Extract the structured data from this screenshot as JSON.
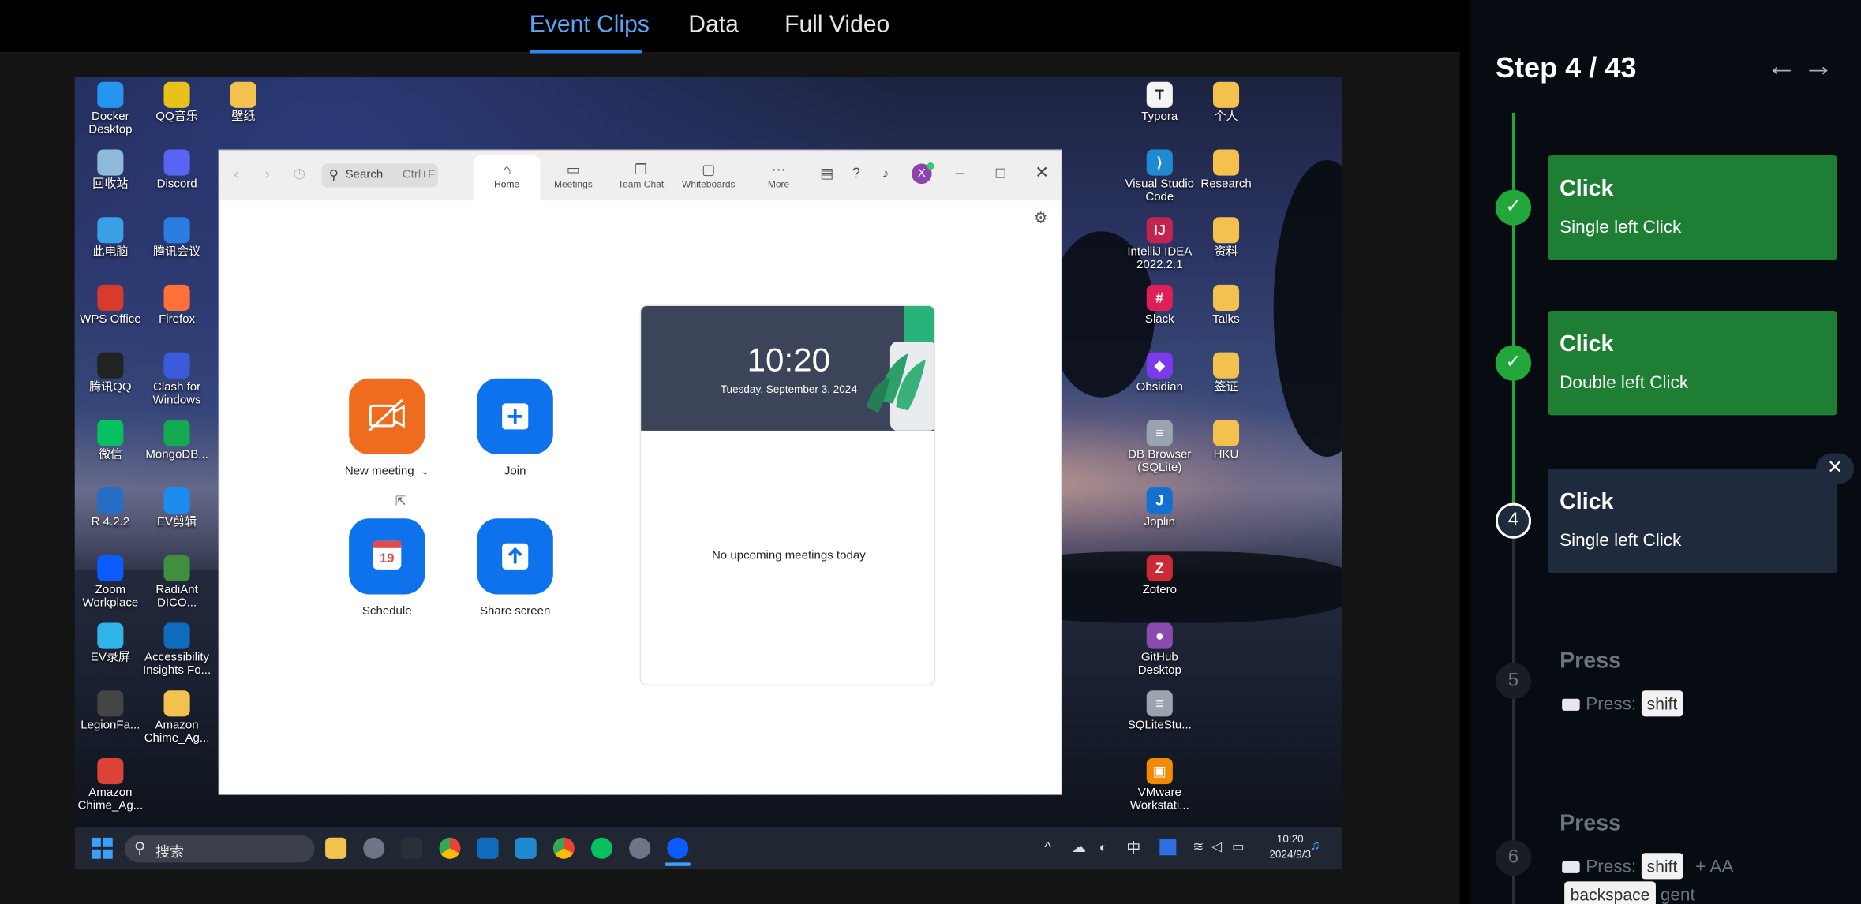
{
  "tabs": [
    "Event Clips",
    "Data",
    "Full Video"
  ],
  "desktop": {
    "left_icons": [
      {
        "label": "Docker Desktop",
        "icon": "docker-icon",
        "color": "#2496ed"
      },
      {
        "label": "QQ音乐",
        "icon": "qqmusic-icon",
        "color": "#e8c21b"
      },
      {
        "label": "壁纸",
        "icon": "folder-icon",
        "color": "#f2c14e"
      },
      {
        "label": "回收站",
        "icon": "recycle-bin-icon",
        "color": "#8fb9d9"
      },
      {
        "label": "Discord",
        "icon": "discord-icon",
        "color": "#5865f2"
      },
      {
        "label": "此电脑",
        "icon": "computer-icon",
        "color": "#3aa0e6"
      },
      {
        "label": "腾讯会议",
        "icon": "tencent-meeting-icon",
        "color": "#2a7de1"
      },
      {
        "label": "WPS Office",
        "icon": "wps-icon",
        "color": "#d73b2c"
      },
      {
        "label": "Firefox",
        "icon": "firefox-icon",
        "color": "#ff7139"
      },
      {
        "label": "腾讯QQ",
        "icon": "qq-icon",
        "color": "#222222"
      },
      {
        "label": "Clash for Windows",
        "icon": "clash-icon",
        "color": "#3b5bdb"
      },
      {
        "label": "微信",
        "icon": "wechat-icon",
        "color": "#07c160"
      },
      {
        "label": "MongoDB...",
        "icon": "mongodb-icon",
        "color": "#13aa52"
      },
      {
        "label": "R 4.2.2",
        "icon": "r-icon",
        "color": "#276dc3"
      },
      {
        "label": "EV剪辑",
        "icon": "ev-edit-icon",
        "color": "#1c8cf0"
      },
      {
        "label": "Zoom Workplace",
        "icon": "zoom-icon",
        "color": "#0b5cff"
      },
      {
        "label": "RadiAnt DICO...",
        "icon": "radiant-icon",
        "color": "#3f8f3f"
      },
      {
        "label": "EV录屏",
        "icon": "ev-record-icon",
        "color": "#2fb5e8"
      },
      {
        "label": "Accessibility Insights Fo...",
        "icon": "accessibility-icon",
        "color": "#0f6cbd"
      },
      {
        "label": "LegionFa...",
        "icon": "legion-icon",
        "color": "#444444"
      },
      {
        "label": "Amazon Chime_Ag...",
        "icon": "folder-icon",
        "color": "#f2c14e"
      },
      {
        "label": "Amazon Chime_Ag...",
        "icon": "chrome-icon",
        "color": "#db4437"
      }
    ],
    "right_icons": [
      {
        "label": "Typora",
        "icon": "typora-icon",
        "color": "#f4f4f4",
        "glyph": "T"
      },
      {
        "label": "个人",
        "icon": "folder-icon",
        "color": "#f2c14e",
        "glyph": ""
      },
      {
        "label": "Visual Studio Code",
        "icon": "vscode-icon",
        "color": "#1f8ad2",
        "glyph": "⟩"
      },
      {
        "label": "Research",
        "icon": "folder-icon",
        "color": "#f2c14e",
        "glyph": ""
      },
      {
        "label": "IntelliJ IDEA 2022.2.1",
        "icon": "intellij-icon",
        "color": "#c3244f",
        "glyph": "IJ"
      },
      {
        "label": "资料",
        "icon": "folder-icon",
        "color": "#f2c14e",
        "glyph": ""
      },
      {
        "label": "Slack",
        "icon": "slack-icon",
        "color": "#e01e5a",
        "glyph": "#"
      },
      {
        "label": "Talks",
        "icon": "folder-icon",
        "color": "#f2c14e",
        "glyph": ""
      },
      {
        "label": "Obsidian",
        "icon": "obsidian-icon",
        "color": "#7c3aed",
        "glyph": "◆"
      },
      {
        "label": "签证",
        "icon": "folder-icon",
        "color": "#f2c14e",
        "glyph": ""
      },
      {
        "label": "DB Browser (SQLite)",
        "icon": "database-icon",
        "color": "#9aa3b0",
        "glyph": "≡"
      },
      {
        "label": "HKU",
        "icon": "folder-icon",
        "color": "#f2c14e",
        "glyph": ""
      },
      {
        "label": "Joplin",
        "icon": "joplin-icon",
        "color": "#1071d3",
        "glyph": "J"
      },
      {
        "label": "Zotero",
        "icon": "zotero-icon",
        "color": "#cc2936",
        "glyph": "Z"
      },
      {
        "label": "GitHub Desktop",
        "icon": "github-icon",
        "color": "#8a4baf",
        "glyph": "●"
      },
      {
        "label": "SQLiteStu...",
        "icon": "sqlite-icon",
        "color": "#9aa3b0",
        "glyph": "≡"
      },
      {
        "label": "VMware Workstati...",
        "icon": "vmware-icon",
        "color": "#f38b00",
        "glyph": "▣"
      }
    ]
  },
  "zoom": {
    "search_placeholder": "Search",
    "search_shortcut": "Ctrl+F",
    "tabs": [
      "Home",
      "Meetings",
      "Team Chat",
      "Whiteboards",
      "More"
    ],
    "avatar_letter": "X",
    "actions": [
      "New meeting",
      "Join",
      "Schedule",
      "Share screen"
    ],
    "schedule_day": "19",
    "time": "10:20",
    "date": "Tuesday, September 3, 2024",
    "no_meetings": "No upcoming meetings today",
    "colors": {
      "new_meeting": "#ef6c1f",
      "blue": "#0e72ed"
    }
  },
  "taskbar": {
    "search_label": "搜索",
    "ime": "中",
    "clock_time": "10:20",
    "clock_date": "2024/9/3"
  },
  "sidebar": {
    "step_label": "Step 4 / 43",
    "prev_icon": "arrow-left-icon",
    "next_icon": "arrow-right-icon",
    "steps": [
      {
        "title": "Click",
        "subtitle": "Single left Click",
        "status": "done"
      },
      {
        "title": "Click",
        "subtitle": "Double left Click",
        "status": "done"
      },
      {
        "number": "4",
        "title": "Click",
        "subtitle": "Single left Click",
        "status": "current"
      },
      {
        "number": "5",
        "title": "Press",
        "press_label": "Press:",
        "keys": [
          "shift"
        ]
      },
      {
        "number": "6",
        "title": "Press",
        "press_label": "Press:",
        "keys": [
          "shift",
          "backspace"
        ],
        "text_after_shift": "+ AA",
        "text_after_backspace": "gent"
      }
    ],
    "colors": {
      "done": "#1e7e34",
      "current": "#1f2a3d",
      "line_done": "#22a83a",
      "line_pending": "#2a2f36"
    }
  }
}
